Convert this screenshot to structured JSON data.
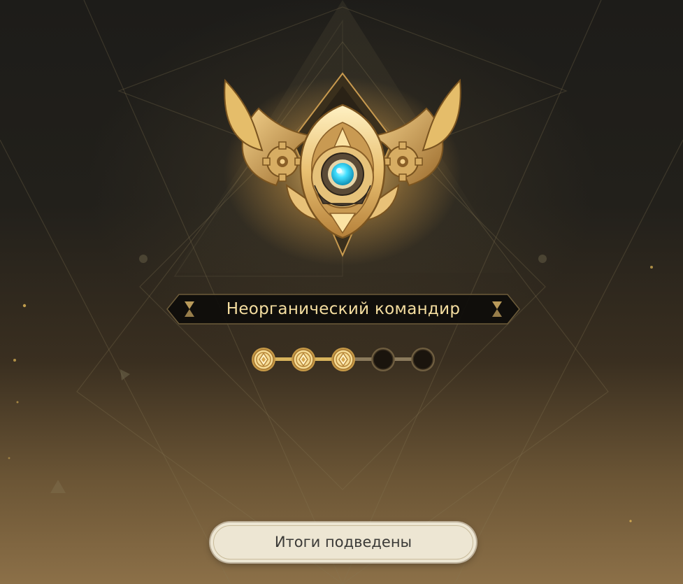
{
  "rank": {
    "title": "Неорганический командир",
    "emblem_icon": "commander-emblem-icon",
    "stars_filled": 3,
    "stars_total": 5
  },
  "actions": {
    "confirm_label": "Итоги подведены"
  },
  "colors": {
    "accent_gold": "#f1d27f",
    "title_text": "#f5dea0",
    "gem_cyan": "#38d8ff",
    "button_bg": "#ede6d3",
    "button_text": "#3b3a37"
  }
}
